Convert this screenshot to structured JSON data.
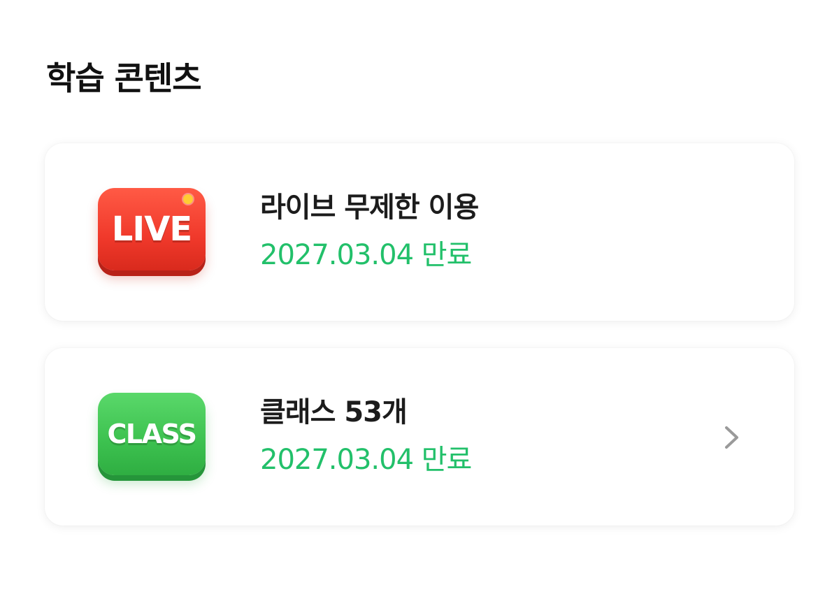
{
  "section": {
    "title": "학습 콘텐츠"
  },
  "cards": [
    {
      "badge_text": "LIVE",
      "badge_color": "#f0392b",
      "title": "라이브 무제한 이용",
      "subtitle": "2027.03.04 만료",
      "has_chevron": false
    },
    {
      "badge_text": "CLASS",
      "badge_color": "#3cc14f",
      "title": "클래스 53개",
      "subtitle": "2027.03.04 만료",
      "has_chevron": true,
      "chevron_icon": "chevron-right-icon"
    }
  ],
  "colors": {
    "subtitle": "#22c06a",
    "title": "#1c1c1c",
    "chevron": "#9a9a9a"
  }
}
